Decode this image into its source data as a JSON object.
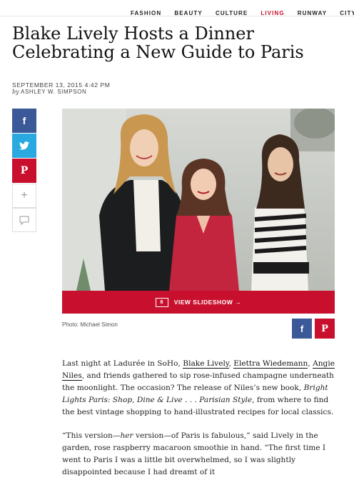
{
  "nav": {
    "items": [
      "FASHION",
      "BEAUTY",
      "CULTURE",
      "LIVING",
      "RUNWAY",
      "CITY GU"
    ],
    "active": "LIVING"
  },
  "article": {
    "title": "Blake Lively Hosts a Dinner Celebrating a New Guide to Paris",
    "date": "SEPTEMBER 13, 2015 4:42 PM",
    "by": "by",
    "author": "ASHLEY W. SIMPSON"
  },
  "share": {
    "facebook": "f",
    "twitter": "t",
    "pinterest": "P",
    "plus": "+",
    "comment": "comment"
  },
  "slideshow": {
    "count": "8",
    "label": "VIEW SLIDESHOW",
    "arrow": "→"
  },
  "caption": "Photo: Michael Simon",
  "paragraphs": {
    "p1": {
      "pre": "Last night at Ladurée in SoHo, ",
      "link1": "Blake Lively",
      "sep1": ", ",
      "link2": "Elettra Wiedemann",
      "sep2": ", ",
      "link3": "Angie Niles",
      "mid": ", and friends gathered to sip rose-infused champagne underneath the moonlight. The occasion? The release of Niles’s new book, ",
      "book": "Bright Lights Paris: Shop, Dine & Live . . . Parisian Style",
      "post": ", from where to find the best vintage shopping to hand-illustrated recipes for local classics."
    },
    "p2": {
      "pre": "“This version—",
      "em": "her",
      "post": " version—of Paris is fabulous,” said Lively in the garden, rose raspberry macaroon smoothie in hand. “The first time I went to Paris I was a little bit overwhelmed, so I was slightly disappointed because I had dreamt of it"
    }
  },
  "colors": {
    "accent": "#c8102e",
    "facebook": "#3b5998",
    "twitter": "#29a9e0"
  }
}
